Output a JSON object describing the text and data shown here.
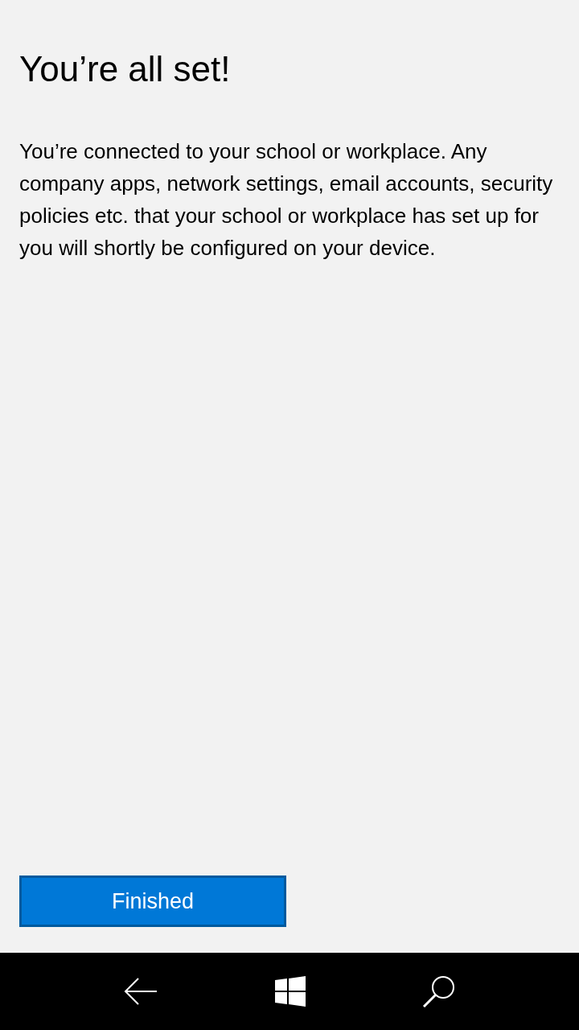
{
  "title": "You’re all set!",
  "message": "You’re connected to your school or workplace. Any company apps, network settings, email accounts, security policies etc. that your school or workplace has set up for you will shortly be configured on your device.",
  "button": {
    "label": "Finished"
  },
  "nav_bar": [
    {
      "kind": "back"
    },
    {
      "kind": "start"
    },
    {
      "kind": "search"
    }
  ]
}
